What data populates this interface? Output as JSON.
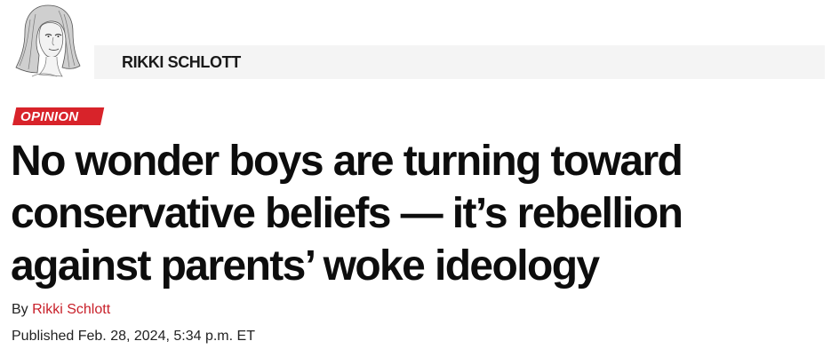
{
  "author_header": {
    "name": "RIKKI SCHLOTT",
    "avatar": "author-sketch-portrait"
  },
  "section_tag": {
    "label": "OPINION",
    "color": "#d8232a"
  },
  "article": {
    "headline": "No wonder boys are turning toward conservative beliefs — it’s rebellion against parents’ woke ideology",
    "byline_prefix": "By",
    "author_link": "Rikki Schlott",
    "published_prefix": "Published",
    "published_date": "Feb. 28, 2024, 5:34 p.m. ET"
  },
  "colors": {
    "link": "#c8202a",
    "band": "#f4f4f4"
  }
}
